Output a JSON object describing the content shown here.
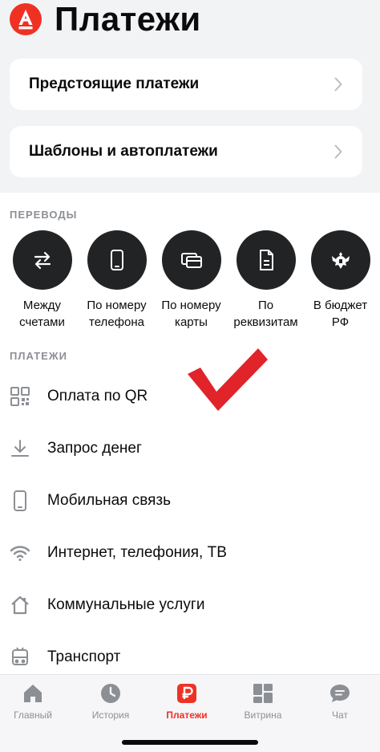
{
  "header": {
    "title": "Платежи",
    "logo_icon": "alfa-bank-logo-icon"
  },
  "cards": [
    {
      "label": "Предстоящие платежи",
      "icon": "chevron-right-icon"
    },
    {
      "label": "Шаблоны и автоплатежи",
      "icon": "chevron-right-icon"
    }
  ],
  "transfers": {
    "section_label": "ПЕРЕВОДЫ",
    "items": [
      {
        "label": "Между\nсчетами",
        "icon": "swap-arrows-icon"
      },
      {
        "label": "По номеру\nтелефона",
        "icon": "phone-icon"
      },
      {
        "label": "По номеру\nкарты",
        "icon": "cards-icon"
      },
      {
        "label": "По\nреквизитам",
        "icon": "document-icon"
      },
      {
        "label": "В бюджет\nРФ",
        "icon": "coat-of-arms-icon"
      }
    ]
  },
  "payments": {
    "section_label": "ПЛАТЕЖИ",
    "items": [
      {
        "label": "Оплата по QR",
        "icon": "qr-code-icon"
      },
      {
        "label": "Запрос денег",
        "icon": "download-icon"
      },
      {
        "label": "Мобильная связь",
        "icon": "mobile-phone-icon"
      },
      {
        "label": "Интернет, телефония, ТВ",
        "icon": "wifi-icon"
      },
      {
        "label": "Коммунальные услуги",
        "icon": "house-icon"
      },
      {
        "label": "Транспорт",
        "icon": "bus-icon"
      }
    ]
  },
  "bottom_nav": {
    "items": [
      {
        "label": "Главный",
        "icon": "home-icon"
      },
      {
        "label": "История",
        "icon": "clock-icon"
      },
      {
        "label": "Платежи",
        "icon": "ruble-icon",
        "active": true
      },
      {
        "label": "Витрина",
        "icon": "showcase-grid-icon"
      },
      {
        "label": "Чат",
        "icon": "chat-bubble-icon"
      }
    ]
  },
  "colors": {
    "brand": "#ef3124",
    "background": "#f2f3f5",
    "circle": "#222325",
    "muted_text": "#8c8f94",
    "checkmark": "#e0242a"
  }
}
